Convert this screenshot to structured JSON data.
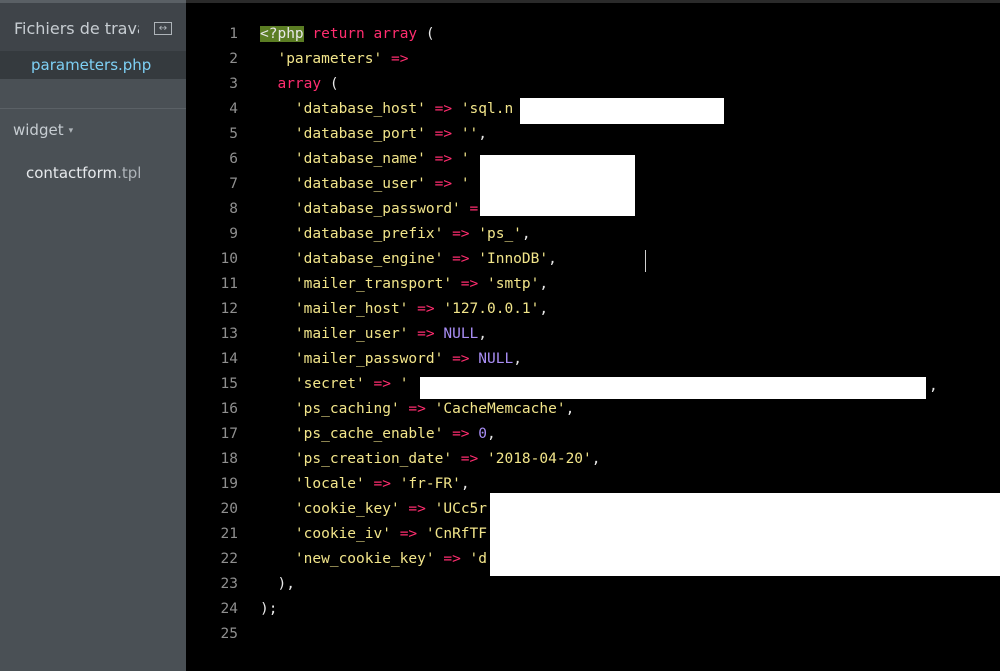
{
  "sidebar": {
    "working_files_title": "Fichiers de travail",
    "split_icon": "split-view-icon",
    "active_file": "parameters.php",
    "folder_name": "widget",
    "folder_caret": "▾",
    "file_name": "contactform",
    "file_ext": ".tpl"
  },
  "editor": {
    "lines": [
      {
        "n": "1",
        "indent": "",
        "tokens": [
          {
            "t": "<?php",
            "c": "tag"
          },
          {
            "t": " "
          },
          {
            "t": "return",
            "c": "kw"
          },
          {
            "t": " "
          },
          {
            "t": "array",
            "c": "kw"
          },
          {
            "t": " ("
          }
        ]
      },
      {
        "n": "2",
        "indent": "  ",
        "tokens": [
          {
            "t": "'parameters'",
            "c": "str"
          },
          {
            "t": " "
          },
          {
            "t": "=>",
            "c": "kw"
          }
        ]
      },
      {
        "n": "3",
        "indent": "  ",
        "tokens": [
          {
            "t": "array",
            "c": "kw"
          },
          {
            "t": " ("
          }
        ]
      },
      {
        "n": "4",
        "indent": "    ",
        "tokens": [
          {
            "t": "'database_host'",
            "c": "str"
          },
          {
            "t": " "
          },
          {
            "t": "=>",
            "c": "kw"
          },
          {
            "t": " "
          },
          {
            "t": "'sql.n",
            "c": "str"
          }
        ]
      },
      {
        "n": "5",
        "indent": "    ",
        "tokens": [
          {
            "t": "'database_port'",
            "c": "str"
          },
          {
            "t": " "
          },
          {
            "t": "=>",
            "c": "kw"
          },
          {
            "t": " "
          },
          {
            "t": "''",
            "c": "str"
          },
          {
            "t": ","
          }
        ]
      },
      {
        "n": "6",
        "indent": "    ",
        "tokens": [
          {
            "t": "'database_name'",
            "c": "str"
          },
          {
            "t": " "
          },
          {
            "t": "=>",
            "c": "kw"
          },
          {
            "t": " "
          },
          {
            "t": "'",
            "c": "str"
          }
        ]
      },
      {
        "n": "7",
        "indent": "    ",
        "tokens": [
          {
            "t": "'database_user'",
            "c": "str"
          },
          {
            "t": " "
          },
          {
            "t": "=>",
            "c": "kw"
          },
          {
            "t": " "
          },
          {
            "t": "'",
            "c": "str"
          }
        ]
      },
      {
        "n": "8",
        "indent": "    ",
        "tokens": [
          {
            "t": "'database_password'",
            "c": "str"
          },
          {
            "t": " "
          },
          {
            "t": "=",
            "c": "kw"
          }
        ]
      },
      {
        "n": "9",
        "indent": "    ",
        "tokens": [
          {
            "t": "'database_prefix'",
            "c": "str"
          },
          {
            "t": " "
          },
          {
            "t": "=>",
            "c": "kw"
          },
          {
            "t": " "
          },
          {
            "t": "'ps_'",
            "c": "str"
          },
          {
            "t": ","
          }
        ]
      },
      {
        "n": "10",
        "indent": "    ",
        "tokens": [
          {
            "t": "'database_engine'",
            "c": "str"
          },
          {
            "t": " "
          },
          {
            "t": "=>",
            "c": "kw"
          },
          {
            "t": " "
          },
          {
            "t": "'InnoDB'",
            "c": "str"
          },
          {
            "t": ","
          }
        ]
      },
      {
        "n": "11",
        "indent": "    ",
        "tokens": [
          {
            "t": "'mailer_transport'",
            "c": "str"
          },
          {
            "t": " "
          },
          {
            "t": "=>",
            "c": "kw"
          },
          {
            "t": " "
          },
          {
            "t": "'smtp'",
            "c": "str"
          },
          {
            "t": ","
          }
        ]
      },
      {
        "n": "12",
        "indent": "    ",
        "tokens": [
          {
            "t": "'mailer_host'",
            "c": "str"
          },
          {
            "t": " "
          },
          {
            "t": "=>",
            "c": "kw"
          },
          {
            "t": " "
          },
          {
            "t": "'127.0.0.1'",
            "c": "str"
          },
          {
            "t": ","
          }
        ]
      },
      {
        "n": "13",
        "indent": "    ",
        "tokens": [
          {
            "t": "'mailer_user'",
            "c": "str"
          },
          {
            "t": " "
          },
          {
            "t": "=>",
            "c": "kw"
          },
          {
            "t": " "
          },
          {
            "t": "NULL",
            "c": "num"
          },
          {
            "t": ","
          }
        ]
      },
      {
        "n": "14",
        "indent": "    ",
        "tokens": [
          {
            "t": "'mailer_password'",
            "c": "str"
          },
          {
            "t": " "
          },
          {
            "t": "=>",
            "c": "kw"
          },
          {
            "t": " "
          },
          {
            "t": "NULL",
            "c": "num"
          },
          {
            "t": ","
          }
        ]
      },
      {
        "n": "15",
        "indent": "    ",
        "tokens": [
          {
            "t": "'secret'",
            "c": "str"
          },
          {
            "t": " "
          },
          {
            "t": "=>",
            "c": "kw"
          },
          {
            "t": " "
          },
          {
            "t": "'",
            "c": "str"
          }
        ]
      },
      {
        "n": "16",
        "indent": "    ",
        "tokens": [
          {
            "t": "'ps_caching'",
            "c": "str"
          },
          {
            "t": " "
          },
          {
            "t": "=>",
            "c": "kw"
          },
          {
            "t": " "
          },
          {
            "t": "'CacheMemcache'",
            "c": "str"
          },
          {
            "t": ","
          }
        ]
      },
      {
        "n": "17",
        "indent": "    ",
        "tokens": [
          {
            "t": "'ps_cache_enable'",
            "c": "str"
          },
          {
            "t": " "
          },
          {
            "t": "=>",
            "c": "kw"
          },
          {
            "t": " "
          },
          {
            "t": "0",
            "c": "num"
          },
          {
            "t": ","
          }
        ]
      },
      {
        "n": "18",
        "indent": "    ",
        "tokens": [
          {
            "t": "'ps_creation_date'",
            "c": "str"
          },
          {
            "t": " "
          },
          {
            "t": "=>",
            "c": "kw"
          },
          {
            "t": " "
          },
          {
            "t": "'2018-04-20'",
            "c": "str"
          },
          {
            "t": ","
          }
        ]
      },
      {
        "n": "19",
        "indent": "    ",
        "tokens": [
          {
            "t": "'locale'",
            "c": "str"
          },
          {
            "t": " "
          },
          {
            "t": "=>",
            "c": "kw"
          },
          {
            "t": " "
          },
          {
            "t": "'fr-FR'",
            "c": "str"
          },
          {
            "t": ","
          }
        ]
      },
      {
        "n": "20",
        "indent": "    ",
        "tokens": [
          {
            "t": "'cookie_key'",
            "c": "str"
          },
          {
            "t": " "
          },
          {
            "t": "=>",
            "c": "kw"
          },
          {
            "t": " "
          },
          {
            "t": "'UCc5r",
            "c": "str"
          }
        ]
      },
      {
        "n": "21",
        "indent": "    ",
        "tokens": [
          {
            "t": "'cookie_iv'",
            "c": "str"
          },
          {
            "t": " "
          },
          {
            "t": "=>",
            "c": "kw"
          },
          {
            "t": " "
          },
          {
            "t": "'CnRfTF",
            "c": "str"
          }
        ]
      },
      {
        "n": "22",
        "indent": "    ",
        "tokens": [
          {
            "t": "'new_cookie_key'",
            "c": "str"
          },
          {
            "t": " "
          },
          {
            "t": "=>",
            "c": "kw"
          },
          {
            "t": " "
          },
          {
            "t": "'d",
            "c": "str"
          }
        ]
      },
      {
        "n": "23",
        "indent": "  ",
        "tokens": [
          {
            "t": "),"
          }
        ]
      },
      {
        "n": "24",
        "indent": "",
        "tokens": [
          {
            "t": ");"
          }
        ]
      },
      {
        "n": "25",
        "indent": "",
        "tokens": []
      }
    ],
    "trailing_comma_15": ","
  }
}
